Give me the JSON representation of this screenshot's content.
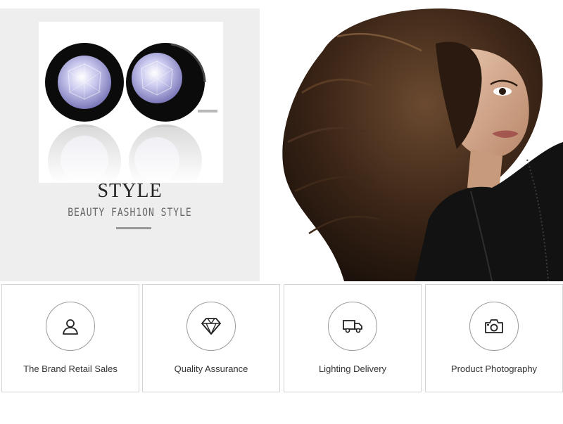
{
  "banner": {
    "title": "STYLE",
    "subtitle": "BEAUTY FASH1ON STYLE"
  },
  "features": [
    {
      "label": "The Brand Retail Sales",
      "icon": "user-icon"
    },
    {
      "label": "Quality Assurance",
      "icon": "diamond-icon"
    },
    {
      "label": "Lighting Delivery",
      "icon": "truck-icon"
    },
    {
      "label": "Product Photography",
      "icon": "camera-icon"
    }
  ],
  "colors": {
    "panel_bg": "#eeeeee",
    "icon_stroke": "#222222",
    "circle_border": "#9a9a9a",
    "card_border": "#d4d4d4"
  }
}
